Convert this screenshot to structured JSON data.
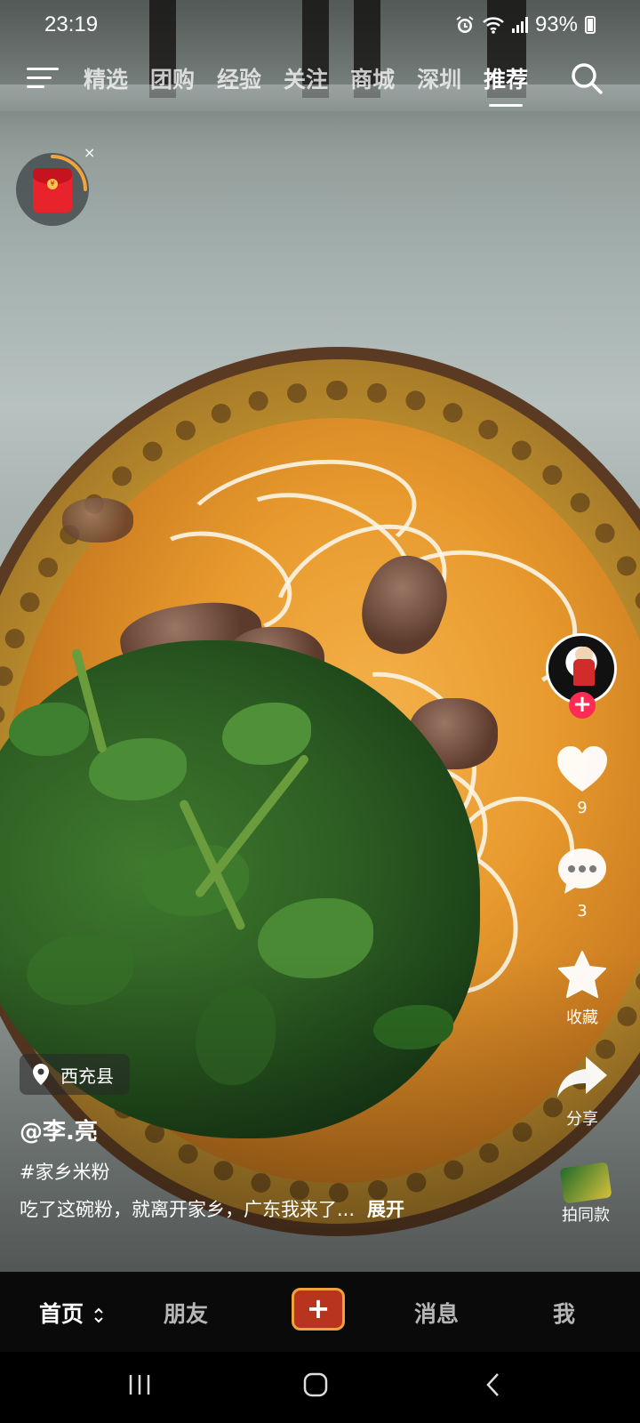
{
  "status_bar": {
    "time": "23:19",
    "battery": "93%",
    "icons": [
      "alarm-icon",
      "wifi-icon",
      "cellular-signal-icon",
      "battery-icon"
    ]
  },
  "top_nav": {
    "tabs": [
      "精选",
      "团购",
      "经验",
      "关注",
      "商城",
      "深圳",
      "推荐"
    ],
    "active_tab": "推荐",
    "menu_icon": "hamburger-menu-icon",
    "search_icon": "search-icon"
  },
  "red_packet": {
    "icon": "red-envelope-icon",
    "close": "×"
  },
  "video": {
    "location": "西充县",
    "author": "@李.亮",
    "hashtag": "#家乡米粉",
    "description": "吃了这碗粉，就离开家乡，广东我来了...",
    "expand": "展开"
  },
  "side_actions": {
    "likes": "9",
    "comments": "3",
    "favorite_label": "收藏",
    "share_label": "分享",
    "same_style_label": "拍同款"
  },
  "bottom_nav": {
    "home": "首页",
    "friends": "朋友",
    "create": "+",
    "messages": "消息",
    "me": "我"
  },
  "colors": {
    "accent": "#fe2c55",
    "create_button_border": "#f0a23a",
    "create_button_fill": "#b8341f",
    "red_packet": "#e8232c"
  }
}
